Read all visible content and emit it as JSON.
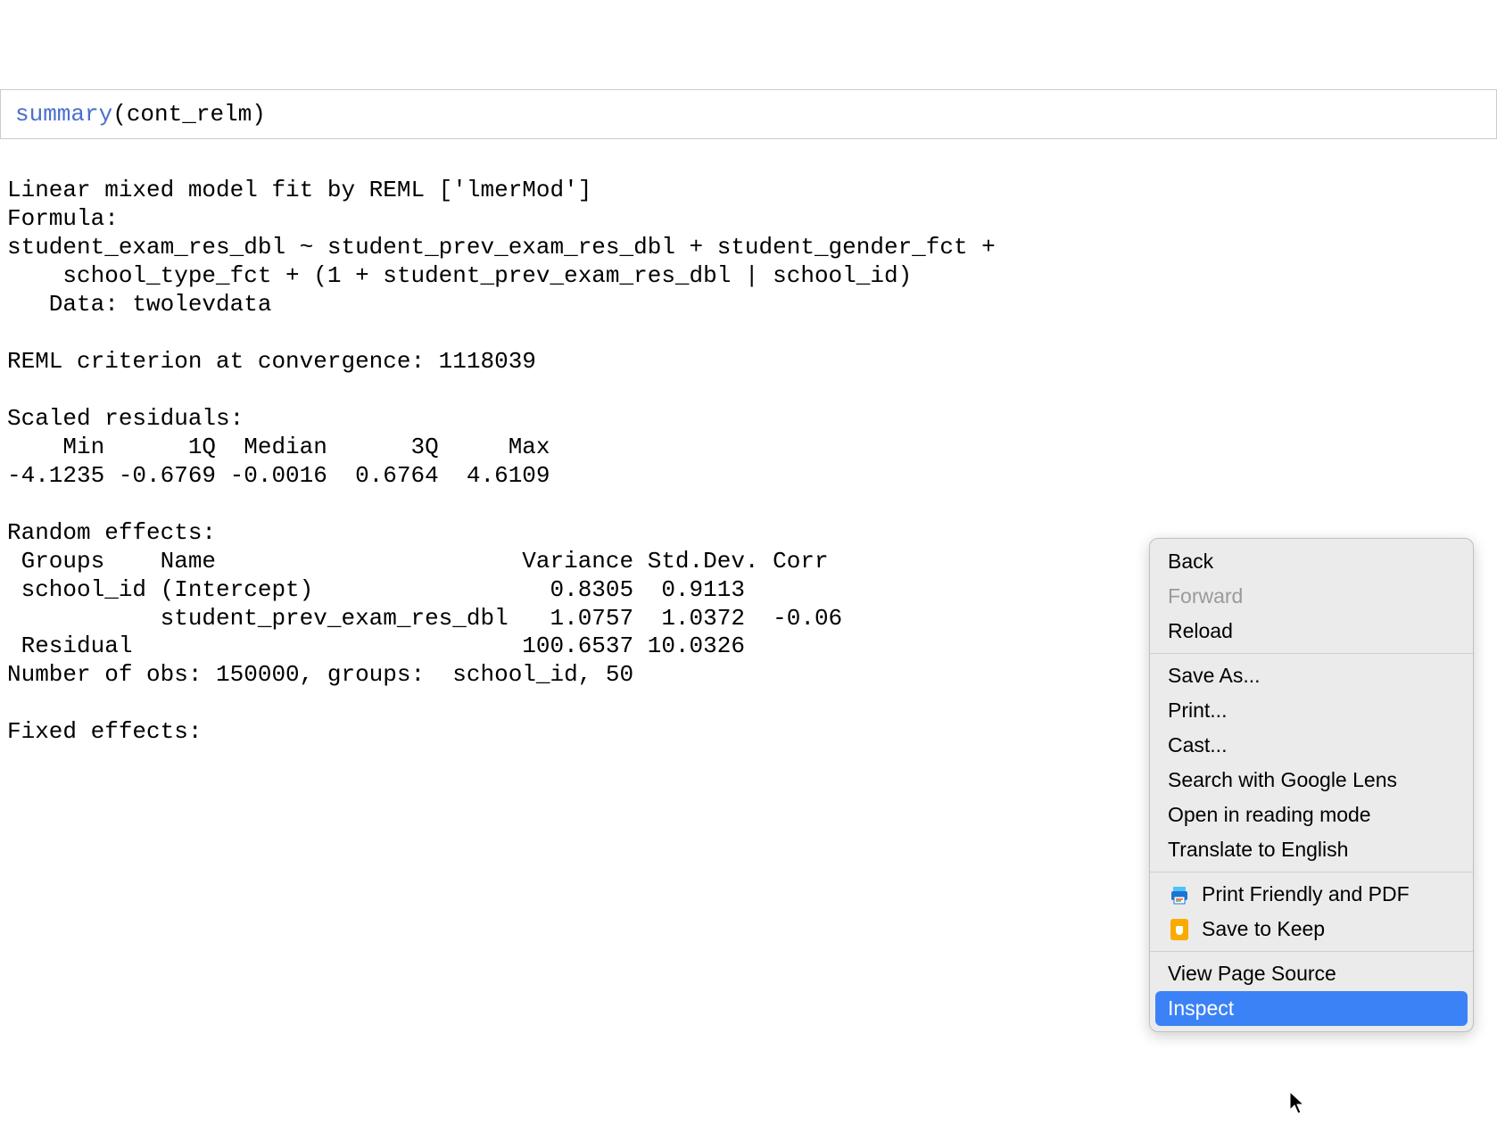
{
  "code": {
    "func": "summary",
    "arg": "cont_relm"
  },
  "output": {
    "line1": "Linear mixed model fit by REML ['lmerMod']",
    "line2": "Formula: ",
    "line3": "student_exam_res_dbl ~ student_prev_exam_res_dbl + student_gender_fct +  ",
    "line4": "    school_type_fct + (1 + student_prev_exam_res_dbl | school_id)",
    "line5": "   Data: twolevdata",
    "line6": "",
    "line7": "REML criterion at convergence: 1118039",
    "line8": "",
    "line9": "Scaled residuals: ",
    "line10": "    Min      1Q  Median      3Q     Max ",
    "line11": "-4.1235 -0.6769 -0.0016  0.6764  4.6109 ",
    "line12": "",
    "line13": "Random effects:",
    "line14": " Groups    Name                      Variance Std.Dev. Corr ",
    "line15": " school_id (Intercept)                 0.8305  0.9113       ",
    "line16": "           student_prev_exam_res_dbl   1.0757  1.0372  -0.06",
    "line17": " Residual                            100.6537 10.0326       ",
    "line18": "Number of obs: 150000, groups:  school_id, 50",
    "line19": "",
    "line20": "Fixed effects:"
  },
  "contextMenu": {
    "back": "Back",
    "forward": "Forward",
    "reload": "Reload",
    "saveAs": "Save As...",
    "print": "Print...",
    "cast": "Cast...",
    "searchLens": "Search with Google Lens",
    "readingMode": "Open in reading mode",
    "translate": "Translate to English",
    "printFriendly": "Print Friendly and PDF",
    "saveKeep": "Save to Keep",
    "viewSource": "View Page Source",
    "inspect": "Inspect"
  }
}
